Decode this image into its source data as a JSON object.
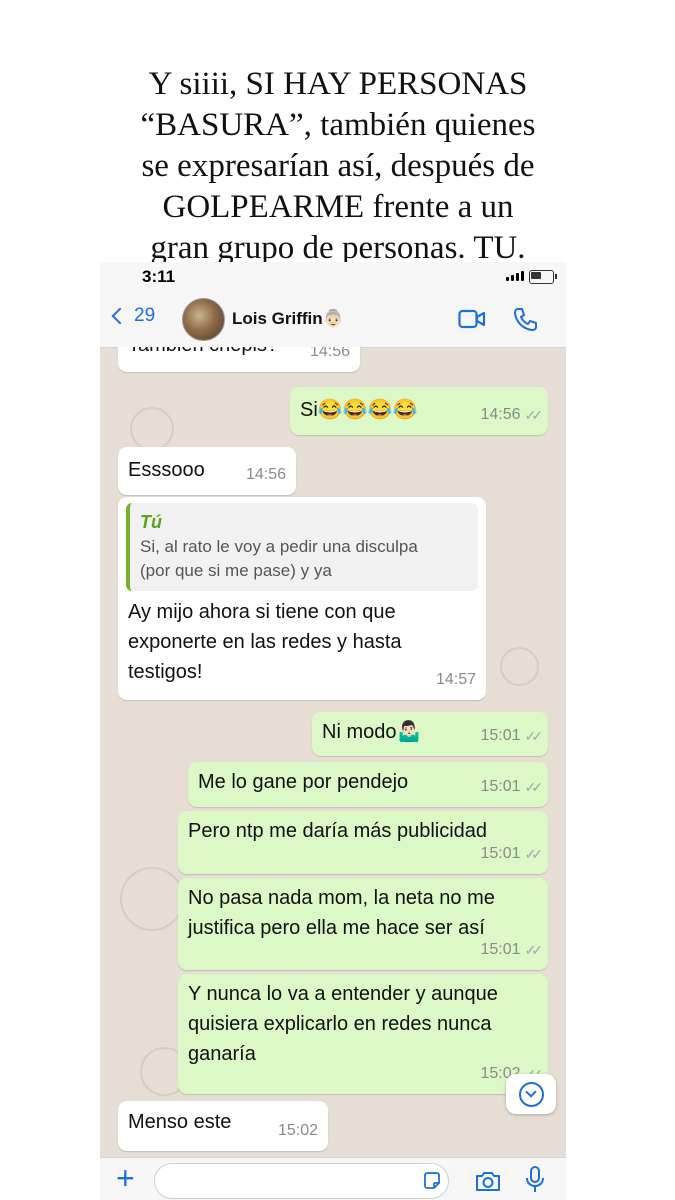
{
  "caption": {
    "lines": [
      "Y siiii, SI HAY PERSONAS",
      "“BASURA”, también quienes",
      "se expresarían así, después de",
      "GOLPEARME frente a un",
      "gran grupo de personas. TU."
    ]
  },
  "status": {
    "time": "3:11"
  },
  "header": {
    "back_count": "29",
    "contact_name": "Lois Griffin👵🏻"
  },
  "messages": [
    {
      "text": "También chepis?",
      "time": "14:56"
    },
    {
      "text": "Si😂😂😂😂",
      "time": "14:56"
    },
    {
      "text": "Esssooo",
      "time": "14:56"
    },
    {
      "quote_author": "Tú",
      "quote_line1": "Si, al rato le voy a pedir  una disculpa",
      "quote_line2": "(por que si me pase) y ya",
      "line1": "Ay mijo ahora si tiene con que",
      "line2": "exponerte en las redes y hasta",
      "line3": "testigos!",
      "time": "14:57"
    },
    {
      "text": "Ni modo🤷🏻‍♂️",
      "time": "15:01"
    },
    {
      "text": "Me lo gane por pendejo",
      "time": "15:01"
    },
    {
      "text": "Pero ntp me daría más publicidad",
      "time": "15:01"
    },
    {
      "line1": "No pasa nada mom, la neta no me",
      "line2": "justifica pero ella me hace ser así",
      "time": "15:01"
    },
    {
      "line1": "Y nunca lo va a entender y aunque",
      "line2": "quisiera explicarlo en redes nunca",
      "line3": "ganaría",
      "time": "15:02"
    },
    {
      "text": "Menso este",
      "time": "15:02"
    }
  ],
  "colors": {
    "accent": "#1d6fd8",
    "outgoing": "#dcf8c6",
    "incoming": "#ffffff",
    "chat_bg": "#e6ddd4",
    "quote_bar": "#75b02e"
  },
  "icons": [
    "back-chevron-icon",
    "video-call-icon",
    "phone-call-icon",
    "scroll-down-icon",
    "plus-icon",
    "sticker-icon",
    "camera-icon",
    "microphone-icon"
  ]
}
